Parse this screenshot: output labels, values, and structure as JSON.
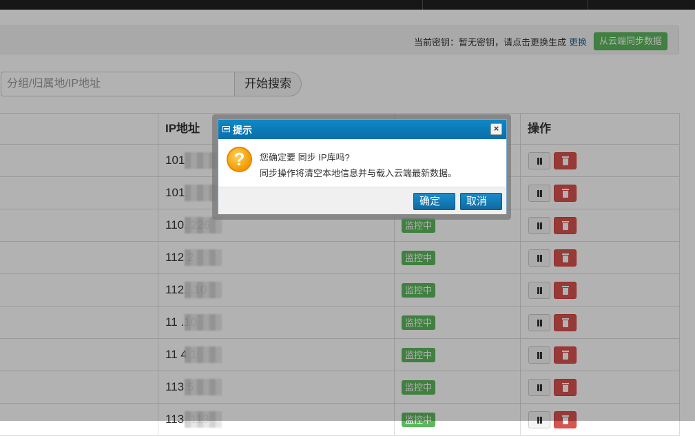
{
  "keybar": {
    "prefix": "当前密钥：暂无密钥，请点击更换生成",
    "change_link": "更换",
    "sync_button": "从云端同步数据"
  },
  "search": {
    "placeholder": "分组/归属地/IP地址",
    "button": "开始搜索"
  },
  "table": {
    "headers": [
      "",
      "IP地址",
      "",
      "操作"
    ],
    "rows": [
      {
        "ip": "101",
        "status": ""
      },
      {
        "ip": "101.",
        "status": ""
      },
      {
        "ip": "110.         226",
        "status": "监控中"
      },
      {
        "ip": "112         2",
        "status": "监控中"
      },
      {
        "ip": "112.         .10",
        "status": "监控中"
      },
      {
        "ip": "11         .10",
        "status": "监控中"
      },
      {
        "ip": "11         4.1",
        "status": "监控中"
      },
      {
        "ip": "113         5",
        "status": "监控中"
      },
      {
        "ip": "113.         113",
        "status": "监控中"
      }
    ]
  },
  "dialog": {
    "title": "提示",
    "close": "×",
    "line1": "您确定要 同步 IP库吗?",
    "line2": "同步操作将清空本地信息并与载入云端最新数据。",
    "ok": "确定",
    "cancel": "取消",
    "icon_glyph": "?"
  }
}
